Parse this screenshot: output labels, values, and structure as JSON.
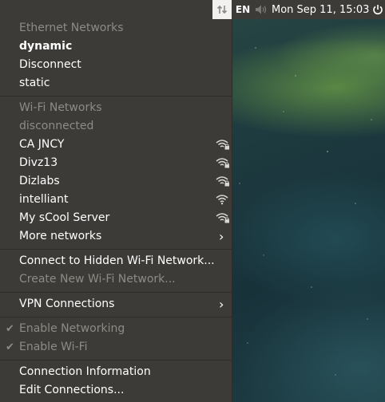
{
  "panel": {
    "keyboard_layout": "EN",
    "clock": "Mon Sep 11, 15:03",
    "icons": [
      "network-icon",
      "volume-icon",
      "power-icon"
    ]
  },
  "menu": {
    "ethernet_header": "Ethernet Networks",
    "ethernet_items": {
      "dynamic": "dynamic",
      "disconnect": "Disconnect",
      "static": "static"
    },
    "wifi_header": "Wi-Fi Networks",
    "wifi_status": "disconnected",
    "wifi_networks": [
      "CA JNCY",
      "Divz13",
      "Dizlabs",
      "intelliant",
      "My sCool Server"
    ],
    "more_networks": "More networks",
    "connect_hidden": "Connect to Hidden Wi-Fi Network...",
    "create_new": "Create New Wi-Fi Network...",
    "vpn": "VPN Connections",
    "enable_networking": "Enable Networking",
    "enable_wifi": "Enable Wi-Fi",
    "connection_info": "Connection Information",
    "edit_connections": "Edit Connections..."
  },
  "colors": {
    "panel_bg": "#3c3b37",
    "menu_text": "#ffffff",
    "menu_text_disabled": "#8d8b85"
  }
}
